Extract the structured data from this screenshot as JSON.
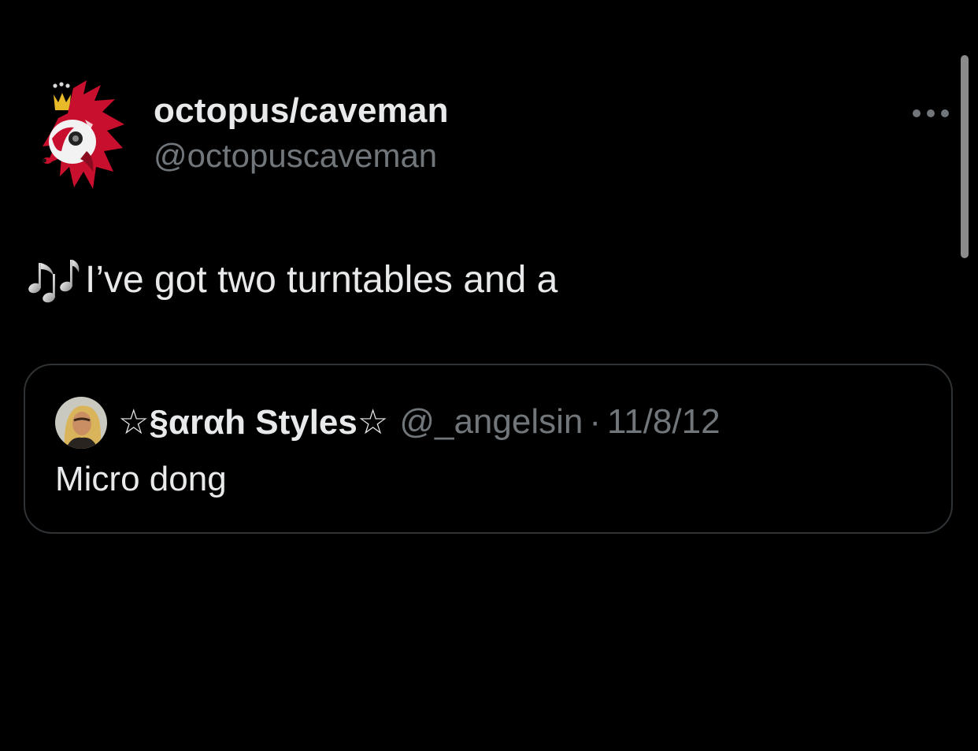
{
  "author": {
    "display_name": "octopus/caveman",
    "handle": "@octopuscaveman",
    "avatar_icon": "red-mascot-avatar-icon"
  },
  "tweet": {
    "leading_icon": "music-notes-icon",
    "text": "I’ve got two turntables and a"
  },
  "more_icon": "more-options-icon",
  "quoted_tweet": {
    "display_name": "☆§αrαh Styles☆",
    "handle": "@_angelsin",
    "separator": "·",
    "date": "11/8/12",
    "text": "Micro dong",
    "avatar_icon": "user-photo-avatar-icon"
  },
  "colors": {
    "background": "#000000",
    "primary_text": "#e7e9ea",
    "secondary_text": "#71767b",
    "border": "#2f3336",
    "avatar_red": "#c8102e"
  }
}
